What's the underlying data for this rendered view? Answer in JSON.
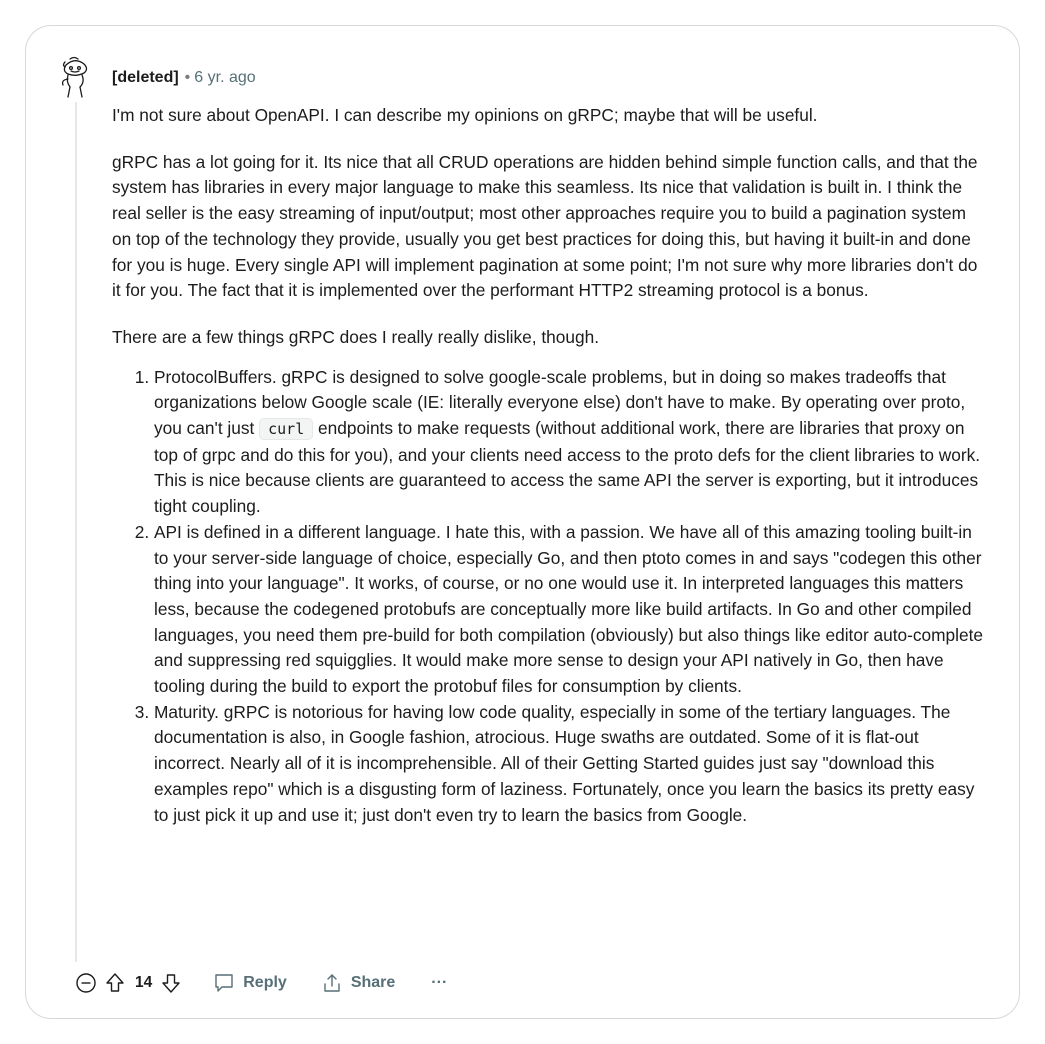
{
  "comment": {
    "author": "[deleted]",
    "separator": "•",
    "age": "6 yr. ago",
    "intro": "I'm not sure about OpenAPI. I can describe my opinions on gRPC; maybe that will be useful.",
    "p2": {
      "hl_going": "gRPC has a lot going for it.",
      "t1": " Its nice that all CRUD operations are hidden behind ",
      "hl_simple": "simple function calls,",
      "t2": " and that the system has libraries in every major language to make this seamless. Its nice that ",
      "hl_validation": "validation is built in.",
      "t3": " I think the real seller is the ",
      "hl_streaming": "easy streaming of input/output;",
      "t4": " most other approaches require you to build a pagination system on top of the technology they provide, usually you get best practices for doing this, but having it built-in and done for you is huge. Every single API will implement pagination at some point; I'm not sure why more libraries don't do it for you. The fact that it is implemented over the performant HTTP2 streaming protocol is a bonus."
    },
    "p3": {
      "t1": "There are ",
      "hl_dislike": "a few things gRPC does I really really dislike, though",
      "t2": "."
    },
    "items": [
      {
        "title": "ProtocolBuffers.",
        "t1": " gRPC is designed to solve google-scale problems, but in doing so makes tradeoffs that organizations below Google scale (IE: literally everyone else) don't have to make. By operating over proto, you can't just ",
        "code": "curl",
        "t2": " endpoints to make requests (without additional work, there are libraries that proxy on top of grpc and do this for you), and your clients need access to the proto defs for the client libraries to work. This is nice because clients are guaranteed to access the same API the server is exporting, but it introduces tight coupling."
      },
      {
        "title": "API is defined in a different language.",
        "t1": " I hate this, with a passion. We have all of this amazing tooling built-in to your server-side language of choice, especially Go, and then ptoto comes in and says \"codegen this other thing into your language\". It works, of course, or no one would use it. In interpreted languages this matters less, because the codegened protobufs are conceptually more like build artifacts. In Go and other compiled languages, you need them pre-build for both compilation (obviously) but also things like editor auto-complete and suppressing red squigglies. It would make more sense to design your API natively in Go, then have tooling during the build to export the protobuf files for consumption by clients."
      },
      {
        "title": "Maturity.",
        "t1": " gRPC is notorious for having low code quality, especially in some of the tertiary languages. The documentation is also, in Google fashion, atrocious. Huge swaths are outdated. Some of it is flat-out incorrect. Nearly all of it is incomprehensible. All of their Getting Started guides just say \"download this examples repo\" which is a disgusting form of laziness. Fortunately, once you learn the basics its pretty easy to just pick it up and use it; just don't even try to learn the basics from Google."
      }
    ]
  },
  "actions": {
    "score": "14",
    "reply_label": "Reply",
    "share_label": "Share",
    "more_label": "···"
  },
  "colors": {
    "highlight_yellow": "#fbf15c",
    "highlight_gray": "#c8c8c8",
    "meta_text": "#576f76"
  },
  "icons": [
    "snoo-avatar-icon",
    "collapse-icon",
    "upvote-icon",
    "downvote-icon",
    "reply-icon",
    "share-icon",
    "more-icon"
  ]
}
